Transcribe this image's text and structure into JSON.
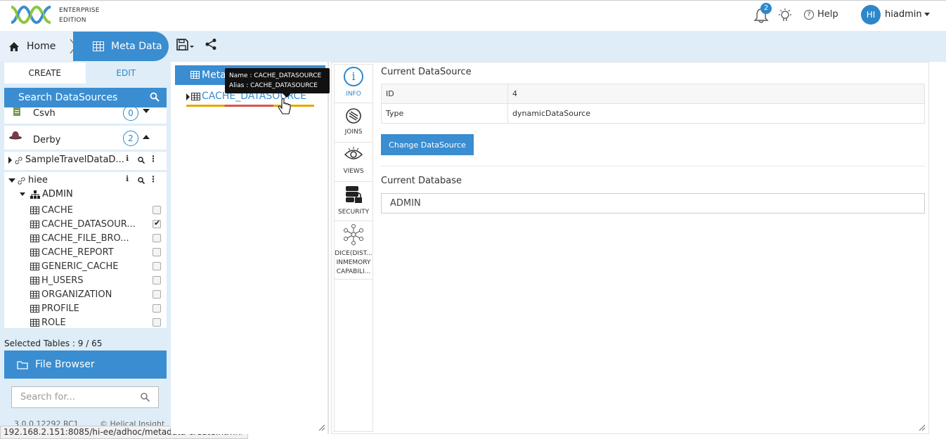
{
  "header": {
    "edition_line1": "ENTERPRISE",
    "edition_line2": "EDITION",
    "notifications_count": "2",
    "help_label": "Help",
    "avatar_initials": "HI",
    "username": "hiadmin"
  },
  "breadcrumb": {
    "home_label": "Home",
    "current_label": "Meta Data"
  },
  "left": {
    "tab_create": "CREATE",
    "tab_edit": "EDIT",
    "search_datasources_label": "Search DataSources",
    "datasources": [
      {
        "name": "Csvh",
        "count": "0"
      },
      {
        "name": "Derby",
        "count": "2"
      }
    ],
    "connection1": "SampleTravelDataD...",
    "connection2": "hiee",
    "schema": "ADMIN",
    "tables": [
      {
        "name": "CACHE",
        "checked": false
      },
      {
        "name": "CACHE_DATASOUR...",
        "checked": true
      },
      {
        "name": "CACHE_FILE_BRO...",
        "checked": false
      },
      {
        "name": "CACHE_REPORT",
        "checked": false
      },
      {
        "name": "GENERIC_CACHE",
        "checked": false
      },
      {
        "name": "H_USERS",
        "checked": false
      },
      {
        "name": "ORGANIZATION",
        "checked": false
      },
      {
        "name": "PROFILE",
        "checked": false
      },
      {
        "name": "ROLE",
        "checked": false
      }
    ],
    "selected_tables": "Selected Tables : 9 / 65",
    "file_browser_label": "File Browser",
    "search_placeholder": "Search for...",
    "version": "3.0.0.12292 RC1",
    "copyright": "© Helical Insight"
  },
  "status_url": "192.168.2.151:8085/hi-ee/adhoc/metadata-create.html#",
  "middle": {
    "meta_header": "Metadata",
    "node_label": "CACHE_DATASOURCE",
    "tooltip_name": "Name : CACHE_DATASOURCE",
    "tooltip_alias": "Alias : CACHE_DATASOURCE"
  },
  "sidetabs": {
    "info": "INFO",
    "joins": "JOINS",
    "views": "VIEWS",
    "security": "SECURITY",
    "dice_line1": "DICE(DIST...",
    "dice_line2": "INMEMORY",
    "dice_line3": "CAPABILI..."
  },
  "detail": {
    "current_datasource_title": "Current DataSource",
    "rows": [
      {
        "key": "ID",
        "value": "4"
      },
      {
        "key": "Type",
        "value": "dynamicDataSource"
      }
    ],
    "change_datasource_label": "Change DataSource",
    "current_database_title": "Current Database",
    "database_value": "ADMIN"
  },
  "colors": {
    "accent": "#3a8dd0",
    "breadcrumb_bg": "#deedf8",
    "logo_green": "#8cc63f"
  }
}
